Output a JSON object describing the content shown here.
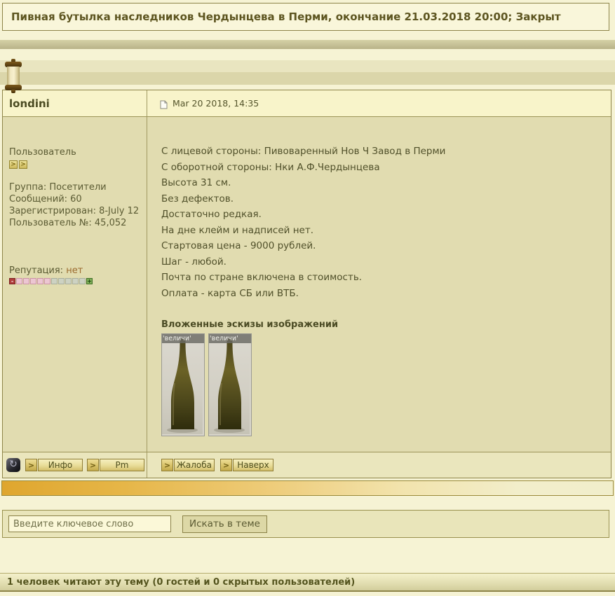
{
  "title_bar": {
    "text": "Пивная бутылка наследников Чердынцева в Перми, окончание 21.03.2018 20:00; Закрыт"
  },
  "post": {
    "author": "londini",
    "date": "Mar 20 2018, 14:35",
    "user_title": "Пользователь",
    "pip_glyph": ">",
    "details": [
      "Группа: Посетители",
      "Сообщений: 60",
      "Зарегистрирован: 8-July 12",
      "Пользователь №: 45,052"
    ],
    "reputation": {
      "label": "Репутация:",
      "value": "нет",
      "minus_glyph": "-",
      "plus_glyph": "+",
      "squares": [
        "minus",
        "pink",
        "pink",
        "pink",
        "pink",
        "pink",
        "gray",
        "gray",
        "gray",
        "gray",
        "gray",
        "plus"
      ]
    },
    "body_lines": [
      "С лицевой стороны: Пивоваренный Нов Ч Завод в Перми",
      "С оборотной стороны: Нки А.Ф.Чердынцева",
      "Высота 31 см.",
      "Без дефектов.",
      "Достаточно редкая.",
      "На дне клейм и надписей нет.",
      "Стартовая цена - 9000 рублей.",
      "Шаг - любой.",
      "Почта по стране включена в стоимость.",
      "Оплата - карта СБ или ВТБ."
    ],
    "attachments_title": "Вложенные эскизы изображений",
    "thumbnails": [
      {
        "caption": "'величи'"
      },
      {
        "caption": "'величи'"
      }
    ],
    "footer_buttons": {
      "arrow": ">",
      "info": "Инфо",
      "pm": "Pm",
      "report": "Жалоба",
      "top": "Наверх"
    },
    "status_icon_glyph": "↻"
  },
  "search": {
    "value": "Введите ключевое слово",
    "button": "Искать в теме"
  },
  "status_bar": {
    "text": "1 человек читают эту тему (0 гостей и 0 скрытых пользователей)"
  },
  "colors": {
    "accent_gold": "#dfa62e",
    "page_bg": "#f6f3d4",
    "cell_bg": "#e1dcb0",
    "border_olive": "#8d8448",
    "rep_minus": "#b03c3c",
    "rep_plus": "#7fae57"
  }
}
